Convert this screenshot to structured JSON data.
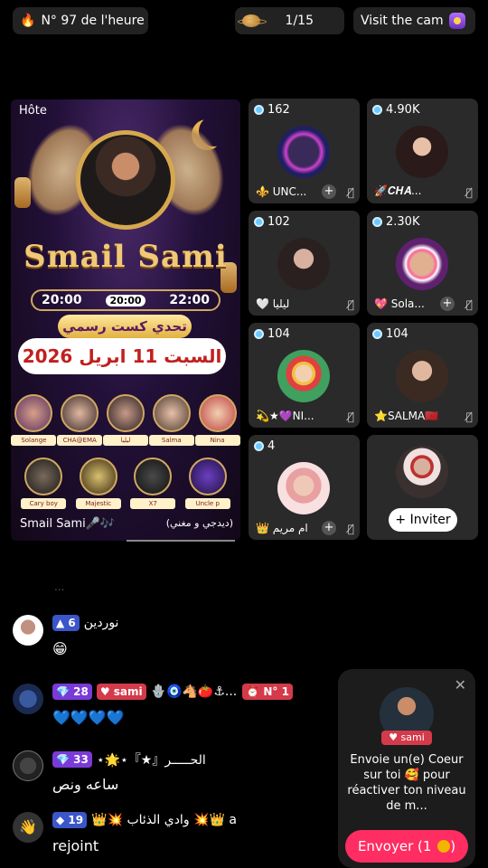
{
  "topbar": {
    "rank_label": "N° 97 de l'heure",
    "page_indicator": "1/15",
    "visit_label": "Visit the cam"
  },
  "host": {
    "label": "Hôte",
    "name": "Smail Sami",
    "times": [
      "20:00",
      "20:00",
      "22:00"
    ],
    "challenge": "تحدي كست رسمي",
    "date": "السبت 11 ابريل 2026",
    "participants_row1": [
      "Solange",
      "CHA@EMA",
      "ليليا",
      "Salma",
      "Nina"
    ],
    "participants_row2": [
      "Cary boy",
      "Majestic",
      "X7",
      "Uncle p"
    ],
    "footer_name": "Smail Sami🎤🎶",
    "footer_sub": "(ديدجي و مغني)"
  },
  "guests": [
    {
      "count": "162",
      "name": "⚜️ UNC...",
      "has_add": true
    },
    {
      "count": "4.90K",
      "name": "🚀𝑪𝑯𝑨...",
      "has_add": false
    },
    {
      "count": "102",
      "name": "🤍 ليليا",
      "has_add": false
    },
    {
      "count": "2.30K",
      "name": "💖 Sola...",
      "has_add": true
    },
    {
      "count": "104",
      "name": "💫★💜NI...",
      "has_add": false
    },
    {
      "count": "104",
      "name": "⭐SALMA🇲🇦",
      "has_add": false
    },
    {
      "count": "4",
      "name": "👑 ام مريم",
      "has_add": true
    }
  ],
  "invite_label": "+ Inviter",
  "chat": {
    "faded_text": "...",
    "messages": [
      {
        "level": "6",
        "name": "نوردين",
        "body": "😁"
      },
      {
        "level": "28",
        "badge": "sami",
        "icons": "🪬🧿🐴🍅⚓...",
        "rank": "N° 1",
        "body": "💙💙💙💙"
      },
      {
        "level": "33",
        "name": "⋆🌟⋆『★』الحـــــر",
        "body": "ساعه ونص"
      },
      {
        "level": "19",
        "name": "👑💥 وادي الذئاب 💥👑 a",
        "body": "rejoint"
      }
    ]
  },
  "popup": {
    "badge": "sami",
    "text": "Envoie un(e) Coeur sur toi 🥰 pour réactiver ton niveau de m...",
    "send_label": "Envoyer (1"
  }
}
